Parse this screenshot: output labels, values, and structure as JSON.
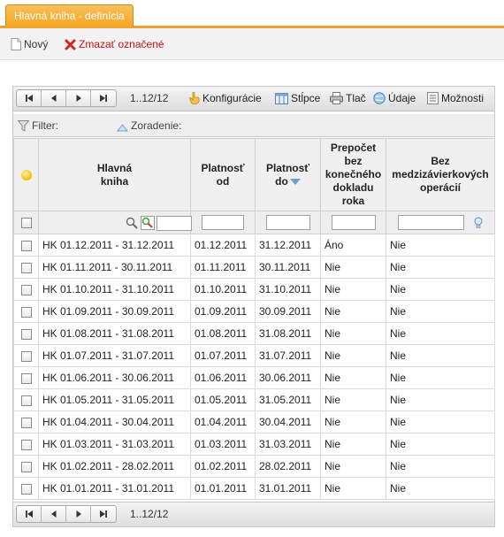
{
  "tab": {
    "label": "Hlavná kniha - definícia"
  },
  "actions": {
    "new_label": "Nový",
    "delete_label": "Zmazať označené"
  },
  "pager": {
    "info": "1..12/12",
    "buttons": [
      "first",
      "previous",
      "next",
      "last"
    ]
  },
  "toolbar": {
    "config": "Konfigurácie",
    "columns": "Stĺpce",
    "print": "Tlač",
    "data": "Údaje",
    "options": "Možnosti"
  },
  "filterbar": {
    "filter_label": "Filter:",
    "sort_label": "Zoradenie:"
  },
  "columns": {
    "book": [
      "Hlavná",
      "kniha"
    ],
    "from": [
      "Platnosť",
      "od"
    ],
    "to": [
      "Platnosť",
      "do"
    ],
    "recalc": [
      "Prepočet",
      "bez",
      "konečného",
      "dokladu",
      "roka"
    ],
    "noclosing": [
      "Bez",
      "medzizávierkových",
      "operácií"
    ]
  },
  "rows": [
    {
      "book": "HK 01.12.2011 - 31.12.2011",
      "from": "01.12.2011",
      "to": "31.12.2011",
      "recalc": "Áno",
      "noclosing": "Nie"
    },
    {
      "book": "HK 01.11.2011 - 30.11.2011",
      "from": "01.11.2011",
      "to": "30.11.2011",
      "recalc": "Nie",
      "noclosing": "Nie"
    },
    {
      "book": "HK 01.10.2011 - 31.10.2011",
      "from": "01.10.2011",
      "to": "31.10.2011",
      "recalc": "Nie",
      "noclosing": "Nie"
    },
    {
      "book": "HK 01.09.2011 - 30.09.2011",
      "from": "01.09.2011",
      "to": "30.09.2011",
      "recalc": "Nie",
      "noclosing": "Nie"
    },
    {
      "book": "HK 01.08.2011 - 31.08.2011",
      "from": "01.08.2011",
      "to": "31.08.2011",
      "recalc": "Nie",
      "noclosing": "Nie"
    },
    {
      "book": "HK 01.07.2011 - 31.07.2011",
      "from": "01.07.2011",
      "to": "31.07.2011",
      "recalc": "Nie",
      "noclosing": "Nie"
    },
    {
      "book": "HK 01.06.2011 - 30.06.2011",
      "from": "01.06.2011",
      "to": "30.06.2011",
      "recalc": "Nie",
      "noclosing": "Nie"
    },
    {
      "book": "HK 01.05.2011 - 31.05.2011",
      "from": "01.05.2011",
      "to": "31.05.2011",
      "recalc": "Nie",
      "noclosing": "Nie"
    },
    {
      "book": "HK 01.04.2011 - 30.04.2011",
      "from": "01.04.2011",
      "to": "30.04.2011",
      "recalc": "Nie",
      "noclosing": "Nie"
    },
    {
      "book": "HK 01.03.2011 - 31.03.2011",
      "from": "01.03.2011",
      "to": "31.03.2011",
      "recalc": "Nie",
      "noclosing": "Nie"
    },
    {
      "book": "HK 01.02.2011 - 28.02.2011",
      "from": "01.02.2011",
      "to": "28.02.2011",
      "recalc": "Nie",
      "noclosing": "Nie"
    },
    {
      "book": "HK 01.01.2011 - 31.01.2011",
      "from": "01.01.2011",
      "to": "31.01.2011",
      "recalc": "Nie",
      "noclosing": "Nie"
    }
  ],
  "colors": {
    "accent": "#f5a623",
    "delete": "#cc1111",
    "sort_arrow": "#6da0d8"
  }
}
